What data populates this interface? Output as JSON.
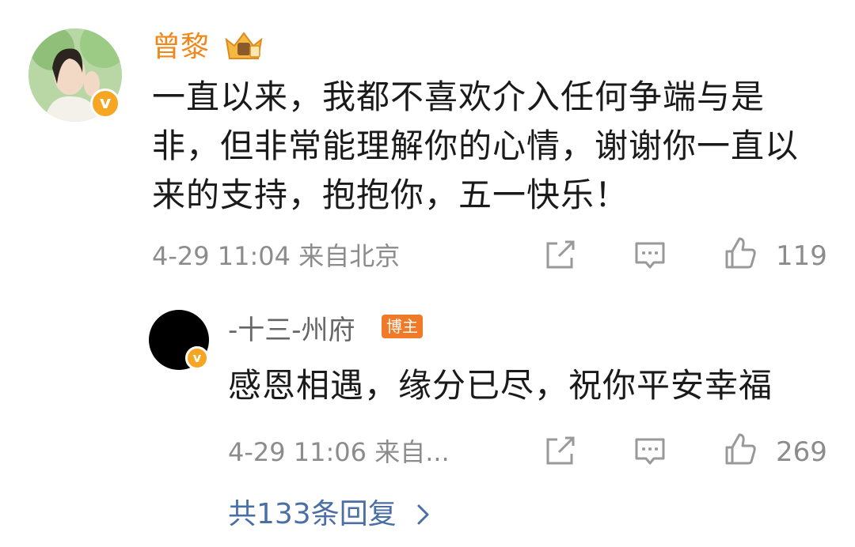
{
  "comment": {
    "author": "曾黎",
    "content": "一直以来，我都不喜欢介入任何争端与是非，但非常能理解你的心情，谢谢你一直以来的支持，抱抱你，五一快乐！",
    "time": "4-29 11:04",
    "location": "来自北京",
    "likes": "119"
  },
  "reply": {
    "author": "-十三-州府",
    "badge": "博主",
    "content": "感恩相遇，缘分已尽，祝你平安幸福",
    "time": "4-29 11:06",
    "location": "来自...",
    "likes": "269"
  },
  "more_replies": "共133条回复",
  "colors": {
    "author_highlight": "#f0871a",
    "badge": "#f07a28",
    "link": "#4a6fa5",
    "verified": "#f6a623"
  },
  "icons": [
    "verified-icon",
    "crown-icon",
    "share-icon",
    "comment-icon",
    "like-icon",
    "chevron-right-icon"
  ]
}
